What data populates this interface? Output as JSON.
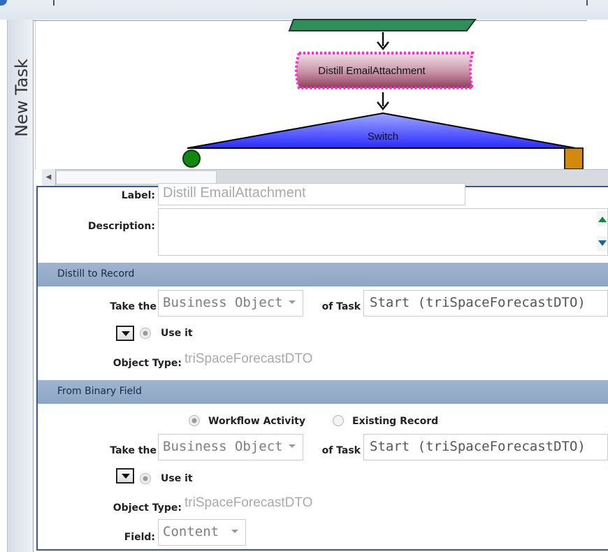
{
  "window": {
    "vertical_tab_label": "New Task"
  },
  "workflow": {
    "node_above": {
      "label": ""
    },
    "distill_node": {
      "label": "Distill EmailAttachment",
      "border_color": "#ff00ff",
      "fill_color": "#a04f62"
    },
    "switch_node": {
      "label": "Switch",
      "fill_color": "#3030f0"
    },
    "left_branch_color": "#118811",
    "right_branch_color": "#d4880c",
    "green_node_color": "#2f8f5b"
  },
  "form": {
    "label_field": {
      "label": "Label:",
      "value": "Distill EmailAttachment"
    },
    "description_field": {
      "label": "Description:",
      "value": ""
    },
    "distill_section": {
      "title": "Distill to Record",
      "take_the_label": "Take the",
      "take_the_value": "Business Object",
      "of_task_label": "of Task",
      "task_value": "Start (triSpaceForecastDTO)",
      "use_it_label": "Use it",
      "object_type_label": "Object Type:",
      "object_type_value": "triSpaceForecastDTO"
    },
    "binary_section": {
      "title": "From Binary Field",
      "workflow_activity_label": "Workflow Activity",
      "existing_record_label": "Existing Record",
      "take_the_label": "Take the",
      "take_the_value": "Business Object",
      "of_task_label": "of Task",
      "task_value": "Start (triSpaceForecastDTO)",
      "use_it_label": "Use it",
      "object_type_label": "Object Type:",
      "object_type_value": "triSpaceForecastDTO",
      "field_label": "Field:",
      "field_value": "Content"
    }
  },
  "colors": {
    "section_header": "#95abca",
    "panel_border": "#3c5c86"
  }
}
